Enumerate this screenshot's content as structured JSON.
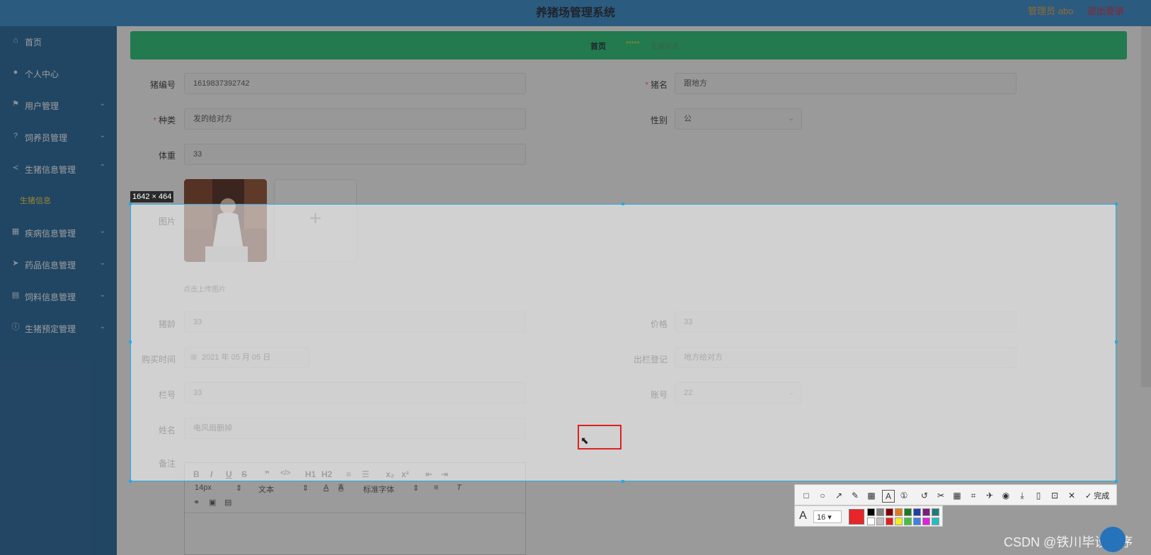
{
  "header": {
    "title": "养猪场管理系统",
    "user": "管理员 abo",
    "logout": "退出登录"
  },
  "sidebar": {
    "items": [
      {
        "label": "首页",
        "icon": "home-icon"
      },
      {
        "label": "个人中心",
        "icon": "user-icon"
      },
      {
        "label": "用户管理",
        "icon": "flag-icon"
      },
      {
        "label": "饲养员管理",
        "icon": "help-icon"
      },
      {
        "label": "生猪信息管理",
        "icon": "share-icon"
      },
      {
        "label": "疾病信息管理",
        "icon": "grid-icon"
      },
      {
        "label": "药品信息管理",
        "icon": "send-icon"
      },
      {
        "label": "饲料信息管理",
        "icon": "book-icon"
      },
      {
        "label": "生猪预定管理",
        "icon": "info-icon"
      }
    ],
    "sub_item": "生猪信息"
  },
  "breadcrumb": {
    "home": "首页",
    "separator": "*****",
    "current": "生猪信息"
  },
  "form": {
    "pig_no": {
      "label": "猪编号",
      "value": "1619837392742"
    },
    "pig_name": {
      "label": "猪名",
      "value": "跟地方",
      "required": true
    },
    "category": {
      "label": "种类",
      "value": "发的给对方",
      "required": true
    },
    "gender": {
      "label": "性别",
      "value": "公"
    },
    "weight": {
      "label": "体重",
      "value": "33"
    },
    "picture": {
      "label": "图片",
      "tip": "点击上传图片",
      "add_symbol": "+"
    },
    "age": {
      "label": "猪龄",
      "value": "33"
    },
    "price": {
      "label": "价格",
      "value": "33"
    },
    "buy_time": {
      "label": "购买时间",
      "value": "2021 年 05 月 05 日"
    },
    "exit_record": {
      "label": "出栏登记",
      "value": "地方给对方"
    },
    "pen_no": {
      "label": "栏号",
      "value": "33"
    },
    "account": {
      "label": "账号",
      "value": "22"
    },
    "name": {
      "label": "姓名",
      "value": "电风扇删掉"
    },
    "remark": {
      "label": "备注"
    }
  },
  "editor_toolbar": {
    "row1": [
      "B",
      "I",
      "U",
      "S",
      "❞",
      "</>",
      "H1",
      "H2",
      "≡",
      "☰",
      "x₂",
      "x²",
      "⇤",
      "⇥"
    ],
    "font_size": "14px",
    "text_type": "文本",
    "font_family": "标准字体"
  },
  "capture": {
    "dimensions": "1642 × 464",
    "done_label": "完成",
    "font_size": "16",
    "current_color": "#e8262a",
    "palette": [
      "#000000",
      "#808080",
      "#800000",
      "#e07a20",
      "#1f7a1f",
      "#1f3fa8",
      "#7a1f7a",
      "#1f7a7a",
      "#ffffff",
      "#c0c0c0",
      "#e02020",
      "#f0f020",
      "#40c040",
      "#4080e0",
      "#e020e0",
      "#20c0c0"
    ]
  },
  "watermark": "CSDN @铁川毕设程序"
}
